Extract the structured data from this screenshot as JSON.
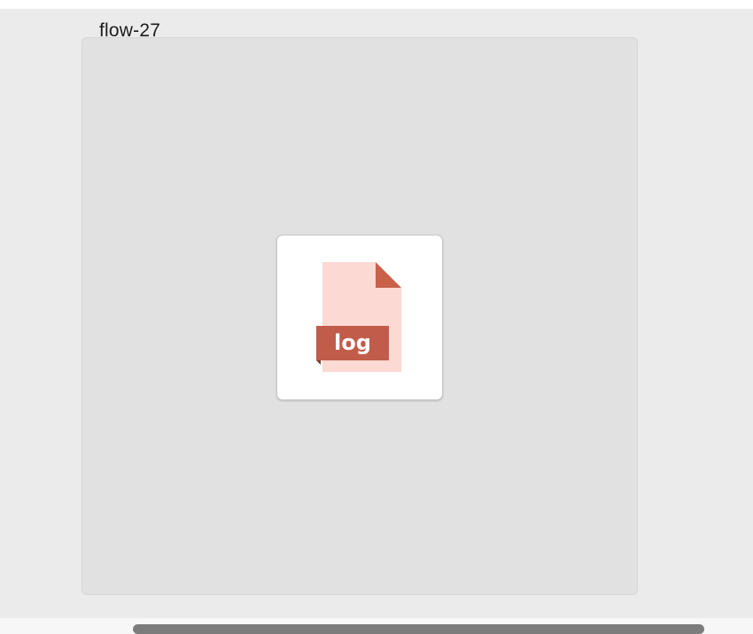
{
  "item": {
    "name": "flow-27"
  },
  "file_icon": {
    "name": "log-file-icon",
    "extension_label": "log",
    "colors": {
      "page": "#fdd9d3",
      "fold": "#c8604a",
      "badge": "#c15c4a",
      "badge_text": "#ffffff"
    }
  }
}
